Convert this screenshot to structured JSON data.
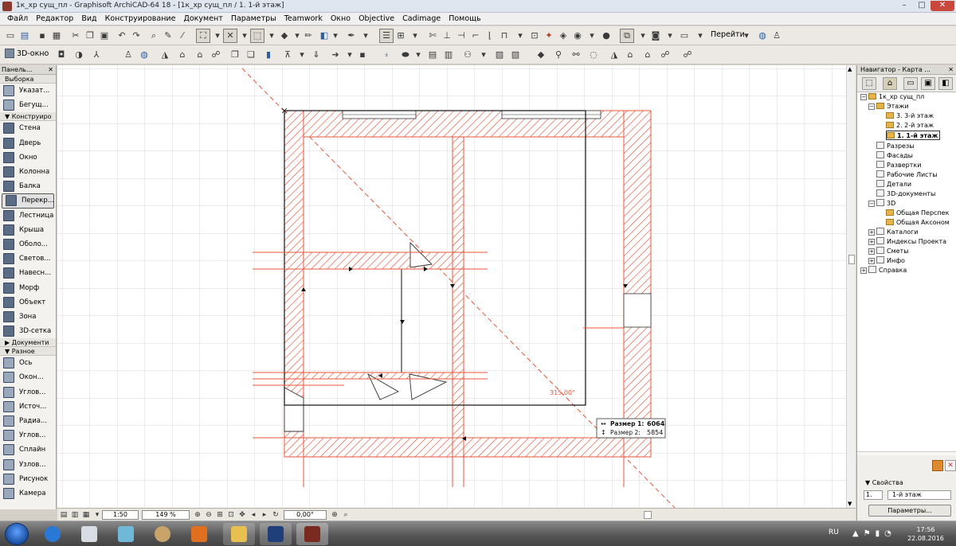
{
  "window": {
    "title": "1к_хр сущ_пл - Graphisoft ArchiCAD-64 18 - [1к_хр сущ_пл / 1. 1-й этаж]",
    "min": "–",
    "max": "□",
    "close": "✕"
  },
  "menu": [
    "Файл",
    "Редактор",
    "Вид",
    "Конструирование",
    "Документ",
    "Параметры",
    "Teamwork",
    "Окно",
    "Objective",
    "Cadimage",
    "Помощь"
  ],
  "toolbar": {
    "go_label": "Перейти",
    "view3d_label": "3D-окно"
  },
  "left_panel": {
    "title": "Панель...",
    "close": "✕",
    "section_select": "Выборка",
    "section_construct": "▼ Конструиро",
    "section_document": "▶ Документи",
    "section_misc": "▼ Разное",
    "select_items": [
      "Указат...",
      "Бегущ..."
    ],
    "construct_items": [
      "Стена",
      "Дверь",
      "Окно",
      "Колонна",
      "Балка",
      "Перекр...",
      "Лестница",
      "Крыша",
      "Оболо...",
      "Светов...",
      "Навесн...",
      "Морф",
      "Объект",
      "Зона",
      "3D-сетка"
    ],
    "misc_items": [
      "Ось",
      "Окон...",
      "Углов...",
      "Источ...",
      "Радиа...",
      "Углов...",
      "Сплайн",
      "Узлов...",
      "Рисунок",
      "Камера"
    ]
  },
  "drawing": {
    "angle_label": "315,00°",
    "size1_label": "Размер 1:",
    "size1_value": "6064",
    "size2_label": "Размер 2:",
    "size2_value": "5854",
    "hatch_color": "#e8553a",
    "line_color": "#111111"
  },
  "status": {
    "scale": "1:50",
    "zoom": "149 %",
    "angle": "0,00°"
  },
  "navigator": {
    "title": "Навигатор - Карта ...",
    "close": "✕",
    "project": "1к_хр сущ_пл",
    "floors_group": "Этажи",
    "floors": [
      "3. 3-й этаж",
      "2. 2-й этаж",
      "1. 1-й этаж"
    ],
    "items": [
      "Разрезы",
      "Фасады",
      "Развертки",
      "Рабочие Листы",
      "Детали",
      "3D-документы"
    ],
    "group_3d": "3D",
    "items_3d": [
      "Общая Перспек",
      "Общая Аксоном"
    ],
    "items_tail": [
      "Каталоги",
      "Индексы Проекта",
      "Сметы",
      "Инфо"
    ],
    "help": "Справка",
    "properties_label": "▼  Свойства",
    "prop_num": "1.",
    "prop_name": "1-й этаж",
    "params_button": "Параметры..."
  },
  "taskbar": {
    "lang": "RU",
    "time": "17:56",
    "date": "22.08.2016"
  }
}
